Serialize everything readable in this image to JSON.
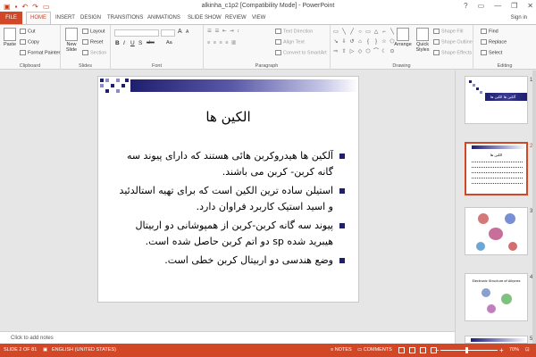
{
  "window": {
    "title": "alkinha_c1p2 [Compatibility Mode] - PowerPoint",
    "controls": [
      "?",
      "▭",
      "—",
      "❐",
      "✕"
    ],
    "signin": "Sign in"
  },
  "tabs": [
    "FILE",
    "HOME",
    "INSERT",
    "DESIGN",
    "TRANSITIONS",
    "ANIMATIONS",
    "SLIDE SHOW",
    "REVIEW",
    "VIEW"
  ],
  "ribbon": {
    "clipboard": {
      "paste": "Paste",
      "cut": "Cut",
      "copy": "Copy",
      "format_painter": "Format Painter",
      "label": "Clipboard"
    },
    "slides": {
      "new_slide": "New Slide",
      "layout": "Layout",
      "reset": "Reset",
      "section": "Section",
      "label": "Slides"
    },
    "font": {
      "label": "Font",
      "bold": "B",
      "italic": "I",
      "underline": "U",
      "strike": "S",
      "abc": "abc",
      "aa": "Aa",
      "grow": "A",
      "shrink": "A"
    },
    "paragraph": {
      "text_direction": "Text Direction",
      "align_text": "Align Text",
      "smartart": "Convert to SmartArt",
      "label": "Paragraph"
    },
    "drawing": {
      "arrange": "Arrange",
      "quick_styles": "Quick Styles",
      "shape_fill": "Shape Fill",
      "shape_outline": "Shape Outline",
      "shape_effects": "Shape Effects",
      "label": "Drawing",
      "shape_glyphs": [
        "▭",
        "╲",
        "╱",
        "○",
        "▭",
        "△",
        "⌐",
        "╲",
        "↘",
        "⇩",
        "↺",
        "⌂",
        "{",
        "}",
        "☆",
        "⬠",
        "⇨",
        "⇧",
        "▷",
        "◇",
        "⬡",
        "⌒",
        "☾",
        "⊙"
      ]
    },
    "editing": {
      "find": "Find",
      "replace": "Replace",
      "select": "Select",
      "label": "Editing"
    }
  },
  "slide": {
    "title": "الکین ها",
    "bullets": [
      "آلکین ها هیدروکربن هائی هستند که دارای پیوند سه گانه کربن- کربن می باشند.",
      "استیلن ساده ترین الکین است که برای تهیه استالدئید و اسید استیک کاربرد فراوان دارد.",
      "پیوند سه گانه کربن-کربن از همپوشانی دو اربیتال هیبرید شده sp دو اتم کربن حاصل شده است.",
      "وضع هندسی دو اربیتال کربن خطی است."
    ]
  },
  "notes_placeholder": "Click to add notes",
  "thumbnails": [
    {
      "num": "1",
      "title": "آلکین ها  الکین ها"
    },
    {
      "num": "2",
      "title": "الکین ها"
    },
    {
      "num": "3",
      "title": ""
    },
    {
      "num": "4",
      "title": "Electronic Structure of Alkynes"
    },
    {
      "num": "5",
      "title": ""
    }
  ],
  "status": {
    "slide_info": "SLIDE 2 OF 81",
    "language": "ENGLISH (UNITED STATES)",
    "notes": "NOTES",
    "comments": "COMMENTS",
    "zoom": "70%",
    "zoom_minus": "−",
    "zoom_plus": "+"
  },
  "colors": {
    "accent": "#d24726",
    "bullet": "#1f1f6f"
  }
}
